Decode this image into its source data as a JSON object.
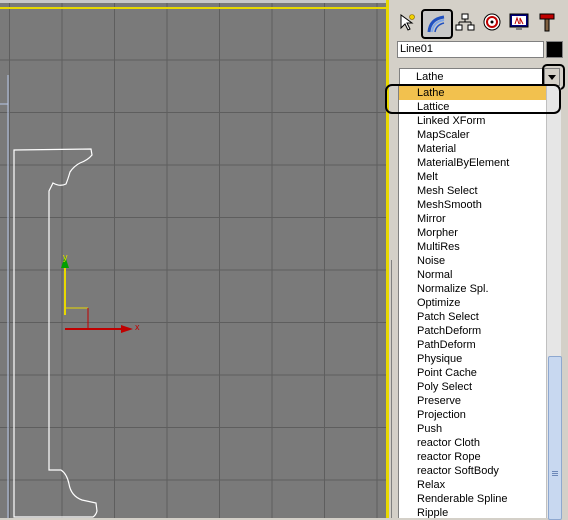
{
  "viewport": {
    "axis_y_label": "y",
    "axis_x_label": "x"
  },
  "command_panel": {
    "tabs": [
      {
        "name": "create",
        "icon": "create-pointer-icon"
      },
      {
        "name": "modify",
        "icon": "modify-arc-icon",
        "active": true
      },
      {
        "name": "hierarchy",
        "icon": "hierarchy-icon"
      },
      {
        "name": "motion",
        "icon": "motion-icon"
      },
      {
        "name": "display",
        "icon": "display-monitor-icon"
      },
      {
        "name": "utilities",
        "icon": "utilities-hammer-icon"
      }
    ],
    "object_name": "Line01",
    "object_color": "#000000",
    "modifier_list": {
      "selected": "Lathe",
      "items": [
        "Lathe",
        "Lattice",
        "Linked XForm",
        "MapScaler",
        "Material",
        "MaterialByElement",
        "Melt",
        "Mesh Select",
        "MeshSmooth",
        "Mirror",
        "Morpher",
        "MultiRes",
        "Noise",
        "Normal",
        "Normalize Spl.",
        "Optimize",
        "Patch Select",
        "PatchDeform",
        "PathDeform",
        "Physique",
        "Point Cache",
        "Poly Select",
        "Preserve",
        "Projection",
        "Push",
        "reactor Cloth",
        "reactor Rope",
        "reactor SoftBody",
        "Relax",
        "Renderable Spline",
        "Ripple"
      ],
      "highlight_color": "#f2c14e"
    }
  }
}
